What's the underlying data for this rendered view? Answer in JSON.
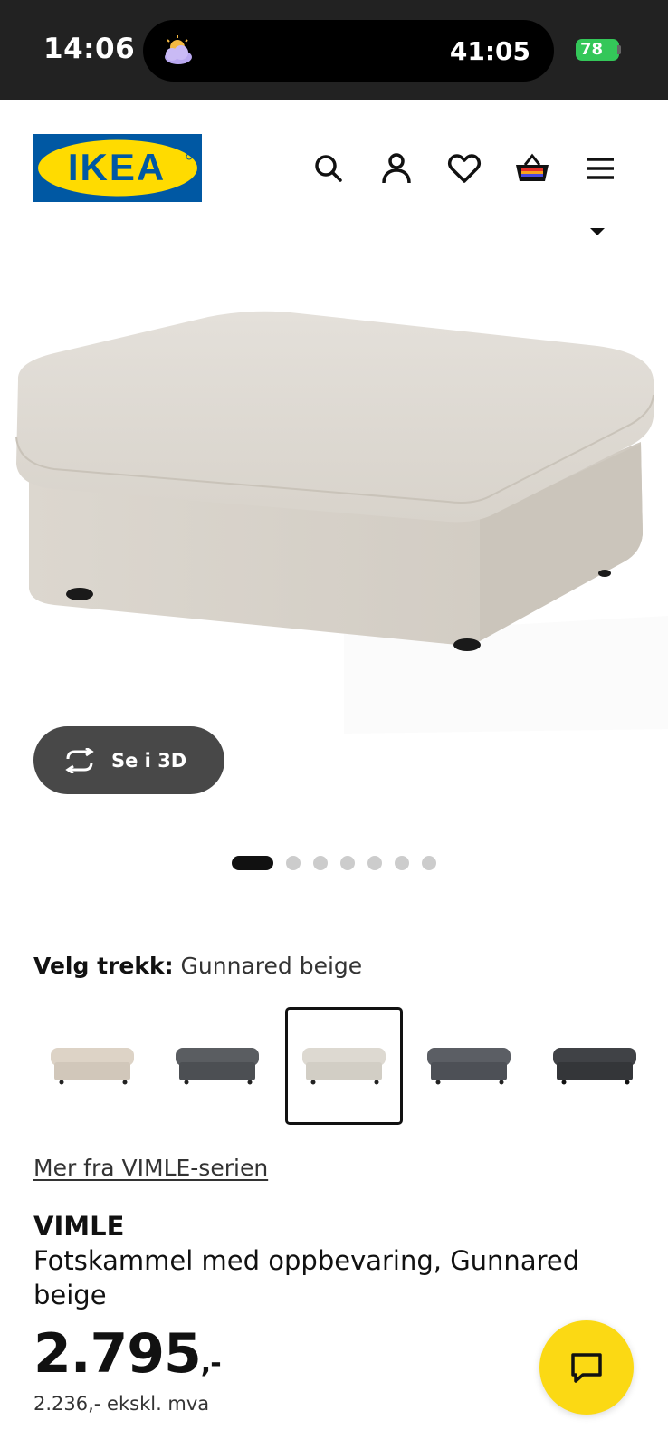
{
  "status_bar": {
    "time": "14:06",
    "timer": "41:05",
    "battery": "78"
  },
  "header": {
    "logo_text": "IKEA",
    "icons": [
      "search-icon",
      "account-icon",
      "heart-icon",
      "basket-icon",
      "menu-icon"
    ]
  },
  "gallery": {
    "button_3d_label": "Se i 3D",
    "dots_total": 7,
    "active_index": 0
  },
  "cover": {
    "label": "Velg trekk:",
    "value": "Gunnared beige",
    "swatches": [
      {
        "name": "beige-light",
        "color": "#d9cfc2"
      },
      {
        "name": "dark-gray",
        "color": "#54575a"
      },
      {
        "name": "gunnared-beige",
        "color": "#d8d4cb",
        "selected": true
      },
      {
        "name": "medium-gray",
        "color": "#55585d"
      },
      {
        "name": "charcoal",
        "color": "#3a3c40"
      }
    ]
  },
  "product": {
    "series_link": "Mer fra VIMLE-serien",
    "name": "VIMLE",
    "description": "Fotskammel med oppbevaring, Gunnared beige",
    "price": "2.795",
    "price_suffix": ",-",
    "price_ex_vat": "2.236,- ekskl. mva"
  },
  "colors": {
    "ikea_blue": "#0058a3",
    "ikea_yellow": "#ffdb00",
    "chat_yellow": "#fbd914"
  }
}
